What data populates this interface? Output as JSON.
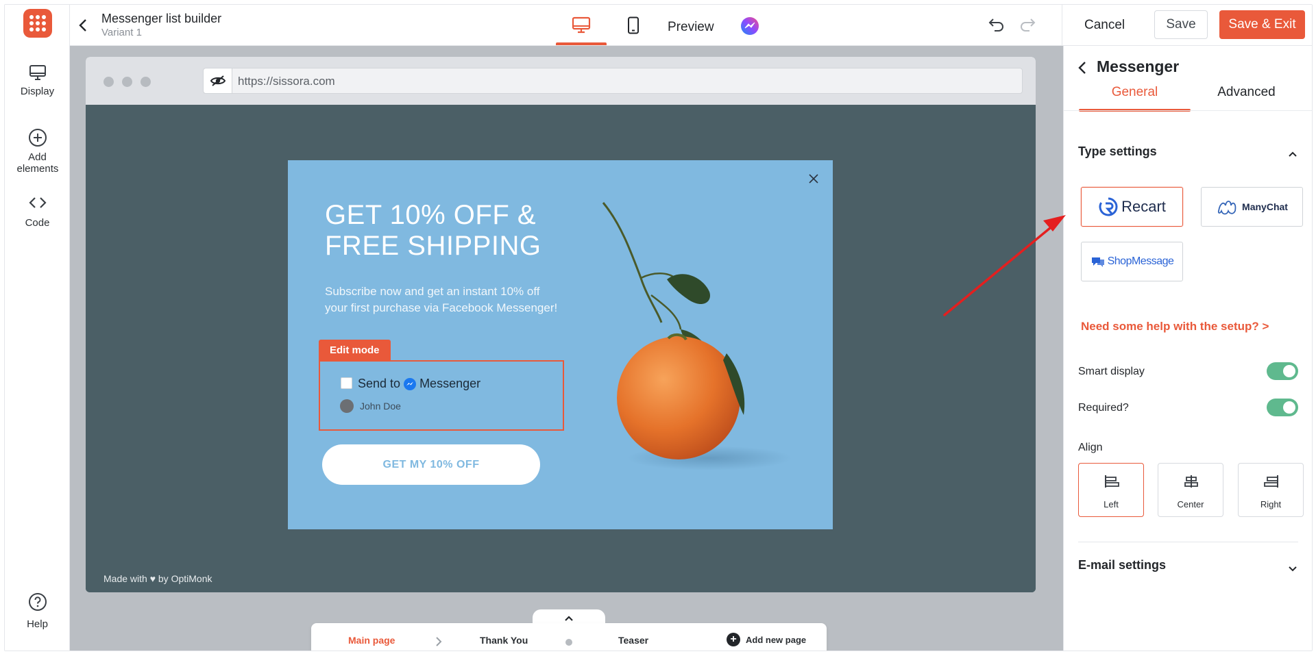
{
  "header": {
    "title": "Messenger list builder",
    "variant": "Variant 1",
    "preview_label": "Preview",
    "cancel_label": "Cancel",
    "save_label": "Save",
    "save_exit_label": "Save & Exit"
  },
  "rail": {
    "items": [
      {
        "label": "Display",
        "icon": "monitor-icon"
      },
      {
        "label": "Add elements",
        "icon": "plus-circle-icon"
      },
      {
        "label": "Code",
        "icon": "code-icon"
      }
    ],
    "help_label": "Help"
  },
  "browser": {
    "url": "https://sissora.com",
    "footer": "Made with ♥ by OptiMonk"
  },
  "popup": {
    "headline": "GET 10% OFF & FREE SHIPPING",
    "subtext": "Subscribe now and get an instant 10% off your first purchase via Facebook Messenger!",
    "edit_tag": "Edit mode",
    "send_to": "Send to",
    "messenger": "Messenger",
    "user_name": "John Doe",
    "cta": "GET MY 10% OFF"
  },
  "pages": {
    "main": "Main page",
    "thank_you": "Thank You",
    "teaser": "Teaser",
    "add": "Add new page"
  },
  "panel": {
    "title": "Messenger",
    "tabs": [
      "General",
      "Advanced"
    ],
    "type_settings": "Type settings",
    "providers": [
      "Recart",
      "ManyChat",
      "ShopMessage"
    ],
    "selected_provider": "Recart",
    "help_link": "Need some help with the setup? >",
    "smart_display": {
      "label": "Smart display",
      "on": true
    },
    "required": {
      "label": "Required?",
      "on": true
    },
    "align_label": "Align",
    "align_options": [
      "Left",
      "Center",
      "Right"
    ],
    "align_selected": "Left",
    "email_settings": "E-mail settings"
  },
  "colors": {
    "accent": "#e9593a",
    "toggle_on": "#5fb98e",
    "popup_bg": "#80b9e0",
    "site_bg": "#4b5f66",
    "workspace_bg": "#babec3"
  }
}
